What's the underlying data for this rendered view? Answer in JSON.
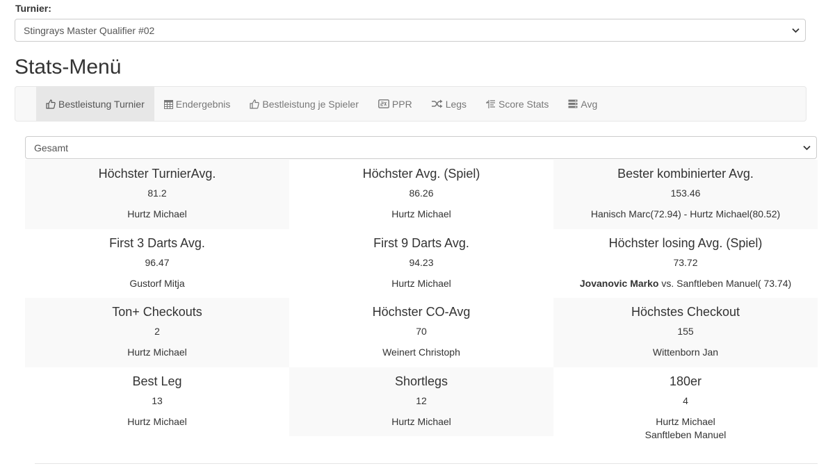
{
  "turnier": {
    "label": "Turnier:",
    "selected": "Stingrays Master Qualifier #02"
  },
  "heading": "Stats-Menü",
  "nav": [
    {
      "label": "Bestleistung Turnier",
      "icon": "thumbs-up-icon",
      "active": true
    },
    {
      "label": "Endergebnis",
      "icon": "calendar-icon",
      "active": false
    },
    {
      "label": "Bestleistung je Spieler",
      "icon": "thumbs-up-icon",
      "active": false
    },
    {
      "label": "PPR",
      "icon": "ppr-icon",
      "active": false
    },
    {
      "label": "Legs",
      "icon": "random-icon",
      "active": false
    },
    {
      "label": "Score Stats",
      "icon": "indent-icon",
      "active": false
    },
    {
      "label": "Avg",
      "icon": "server-icon",
      "active": false
    }
  ],
  "filter": {
    "selected": "Gesamt"
  },
  "stats": [
    {
      "title": "Höchster TurnierAvg.",
      "value": "81.2",
      "player": "Hurtz Michael"
    },
    {
      "title": "Höchster Avg. (Spiel)",
      "value": "86.26",
      "player": "Hurtz Michael"
    },
    {
      "title": "Bester kombinierter Avg.",
      "value": "153.46",
      "player": "Hanisch Marc(72.94) - Hurtz Michael(80.52)"
    },
    {
      "title": "First 3 Darts Avg.",
      "value": "96.47",
      "player": "Gustorf Mitja"
    },
    {
      "title": "First 9 Darts Avg.",
      "value": "94.23",
      "player": "Hurtz Michael"
    },
    {
      "title": "Höchster losing Avg. (Spiel)",
      "value": "73.72",
      "player_bold": "Jovanovic Marko",
      "player": " vs. Sanftleben Manuel( 73.74)"
    },
    {
      "title": "Ton+ Checkouts",
      "value": "2",
      "player": "Hurtz Michael"
    },
    {
      "title": "Höchster CO-Avg",
      "value": "70",
      "player": "Weinert Christoph"
    },
    {
      "title": "Höchstes Checkout",
      "value": "155",
      "player": "Wittenborn Jan"
    },
    {
      "title": "Best Leg",
      "value": "13",
      "player": "Hurtz Michael"
    },
    {
      "title": "Shortlegs",
      "value": "12",
      "player": "Hurtz Michael"
    },
    {
      "title": "180er",
      "value": "4",
      "player": "Hurtz Michael",
      "player2": "Sanftleben Manuel"
    }
  ]
}
